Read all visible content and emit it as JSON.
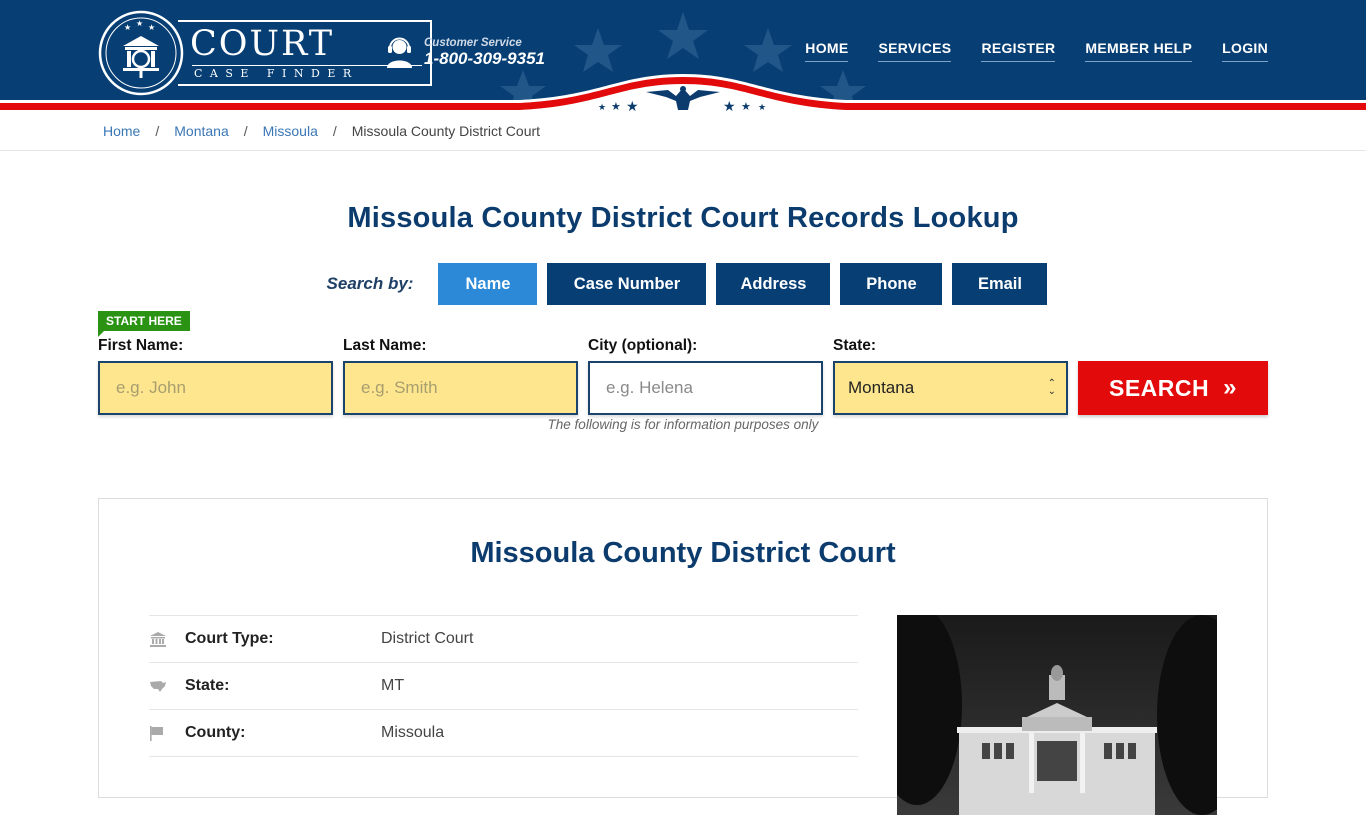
{
  "header": {
    "logo": {
      "main": "COURT",
      "sub": "CASE FINDER"
    },
    "customer_service": {
      "label": "Customer Service",
      "phone": "1-800-309-9351"
    },
    "nav": [
      {
        "label": "HOME"
      },
      {
        "label": "SERVICES"
      },
      {
        "label": "REGISTER"
      },
      {
        "label": "MEMBER HELP"
      },
      {
        "label": "LOGIN"
      }
    ],
    "colors": {
      "primary": "#073f75",
      "accent_red": "#e20a0a"
    }
  },
  "breadcrumb": [
    {
      "label": "Home"
    },
    {
      "label": "Montana"
    },
    {
      "label": "Missoula"
    },
    {
      "label": "Missoula County District Court"
    }
  ],
  "breadcrumb_sep": "/",
  "page_title": "Missoula County District Court Records Lookup",
  "search": {
    "by_label": "Search by:",
    "tabs": [
      {
        "label": "Name",
        "active": true
      },
      {
        "label": "Case Number",
        "active": false
      },
      {
        "label": "Address",
        "active": false
      },
      {
        "label": "Phone",
        "active": false
      },
      {
        "label": "Email",
        "active": false
      }
    ],
    "start_here": "START HERE",
    "fields": {
      "first_name": {
        "label": "First Name:",
        "placeholder": "e.g. John",
        "value": ""
      },
      "last_name": {
        "label": "Last Name:",
        "placeholder": "e.g. Smith",
        "value": ""
      },
      "city": {
        "label": "City (optional):",
        "placeholder": "e.g.  Helena",
        "value": ""
      },
      "state": {
        "label": "State:",
        "value": "Montana"
      }
    },
    "button": "SEARCH",
    "button_icon": "»",
    "note": "The following is for information purposes only"
  },
  "court": {
    "title": "Missoula County District Court",
    "details": [
      {
        "icon": "courthouse-icon",
        "label": "Court Type:",
        "value": "District Court"
      },
      {
        "icon": "usa-map-icon",
        "label": "State:",
        "value": "MT"
      },
      {
        "icon": "flag-icon",
        "label": "County:",
        "value": "Missoula"
      }
    ],
    "photo_alt": "Missoula County Courthouse"
  }
}
